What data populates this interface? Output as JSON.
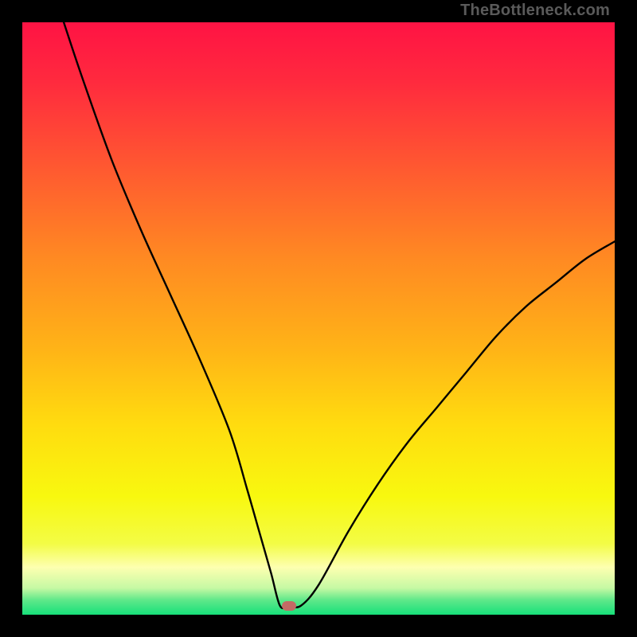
{
  "watermark": "TheBottleneck.com",
  "chart_data": {
    "type": "line",
    "title": "",
    "xlabel": "",
    "ylabel": "",
    "xlim": [
      0,
      100
    ],
    "ylim": [
      0,
      100
    ],
    "series": [
      {
        "name": "bottleneck-curve",
        "x_percent": [
          7,
          10,
          15,
          20,
          25,
          30,
          35,
          38,
          40,
          42,
          43.5,
          45,
          47,
          50,
          55,
          60,
          65,
          70,
          75,
          80,
          85,
          90,
          95,
          100
        ],
        "y_percent": [
          100,
          91,
          77,
          65,
          54,
          43,
          31,
          21,
          14,
          7,
          1.5,
          1.5,
          1.5,
          5,
          14,
          22,
          29,
          35,
          41,
          47,
          52,
          56,
          60,
          63
        ]
      }
    ],
    "optimum_marker": {
      "x_percent": 45,
      "y_percent": 1.5
    },
    "gradient_stops": [
      {
        "pos": 0.0,
        "color": "#ff1344"
      },
      {
        "pos": 0.1,
        "color": "#ff2a3e"
      },
      {
        "pos": 0.25,
        "color": "#ff5a30"
      },
      {
        "pos": 0.4,
        "color": "#ff8a22"
      },
      {
        "pos": 0.55,
        "color": "#ffb317"
      },
      {
        "pos": 0.68,
        "color": "#ffdc0f"
      },
      {
        "pos": 0.8,
        "color": "#f8f80f"
      },
      {
        "pos": 0.88,
        "color": "#f3fc45"
      },
      {
        "pos": 0.92,
        "color": "#fdffb0"
      },
      {
        "pos": 0.955,
        "color": "#c6f9a4"
      },
      {
        "pos": 0.975,
        "color": "#60e88a"
      },
      {
        "pos": 1.0,
        "color": "#17e07a"
      }
    ]
  }
}
